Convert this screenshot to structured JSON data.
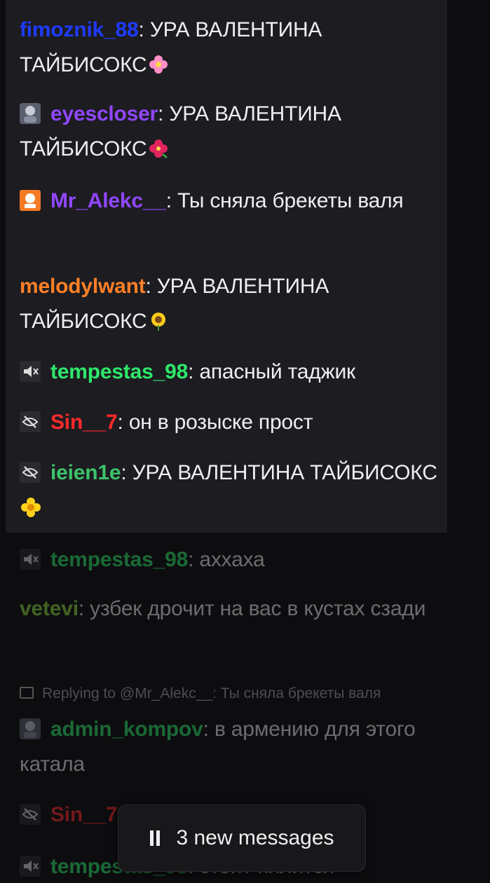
{
  "messages": [
    {
      "user": "fimoznik_88",
      "color": "#1f3bff",
      "text": "УРА ВАЛЕНТИНА ТАЙБИСОКС",
      "emote": "flower-emote",
      "badge": "",
      "highlighted": true
    },
    {
      "user": "eyescloser",
      "color": "#9147ff",
      "text": "УРА ВАЛЕНТИНА ТАЙБИСОКС",
      "emote": "hibiscus-emote",
      "badge": "avatar-badge",
      "highlighted": true
    },
    {
      "user": "Mr_Alekc__",
      "color": "#9147ff",
      "text": "Ты сняла брекеты валя",
      "emote": "",
      "badge": "orange-badge",
      "highlighted": true
    },
    {
      "user": "melodylwant",
      "color": "#ff7f27",
      "text": "УРА ВАЛЕНТИНА ТАЙБИСОКС",
      "emote": "sunflower-emote",
      "badge": "",
      "highlighted": true
    },
    {
      "user": "tempestas_98",
      "color": "#2ee86a",
      "text": "апасный таджик",
      "emote": "",
      "badge": "muted-badge",
      "highlighted": true
    },
    {
      "user": "Sin__7",
      "color": "#ff2a2a",
      "text": "он в розыске прост",
      "emote": "",
      "badge": "hidden-badge",
      "highlighted": true
    },
    {
      "user": "ieien1e",
      "color": "#3dc46a",
      "text": "УРА ВАЛЕНТИНА ТАЙБИСОКС",
      "emote": "blossom-emote",
      "badge": "hidden-badge",
      "highlighted": true
    },
    {
      "user": "tempestas_98",
      "color": "#2ee86a",
      "text": "аххаха",
      "emote": "",
      "badge": "muted-badge",
      "highlighted": false
    },
    {
      "user": "vetevi",
      "color": "#8adb3c",
      "text": "узбек дрочит на вас в кустах сзади",
      "emote": "",
      "badge": "",
      "highlighted": false
    },
    {
      "user": "admin_kompov",
      "color": "#2ee86a",
      "text": "в армению для этого катала",
      "emote": "",
      "badge": "avatar-badge",
      "highlighted": false
    },
    {
      "user": "Sin__7",
      "color": "#ff2a2a",
      "text": "",
      "emote": "",
      "badge": "hidden-badge",
      "highlighted": false
    },
    {
      "user": "tempestas_98",
      "color": "#2ee86a",
      "text": "стоит пялится",
      "emote": "",
      "badge": "muted-badge",
      "highlighted": false
    }
  ],
  "reply": {
    "text": "Replying to @Mr_Alekc__: Ты сняла брекеты валя"
  },
  "new_messages": {
    "label": "3 new messages",
    "icon": "pause-icon"
  },
  "colors": {
    "highlight_bg": "#1c1c21",
    "chat_bg": "#0d0d10",
    "text": "#efeff1"
  }
}
